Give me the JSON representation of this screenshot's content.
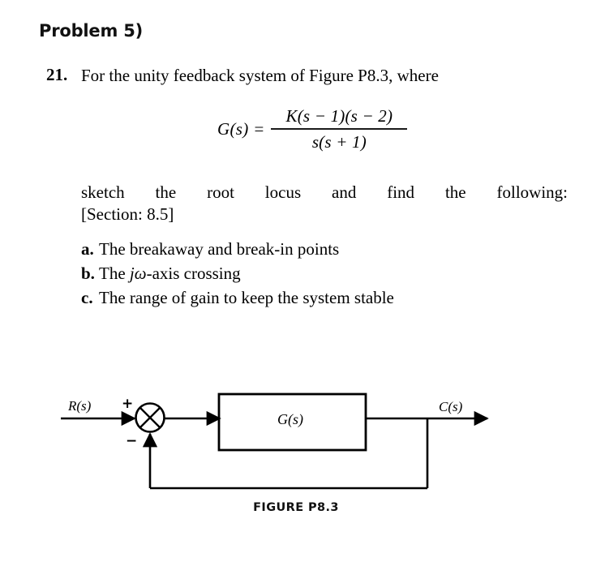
{
  "heading": {
    "title": "Problem 5)"
  },
  "statement": {
    "number": "21.",
    "text": "For the unity feedback system of Figure P8.3, where"
  },
  "equation": {
    "lhs": "G(s)",
    "equals": "=",
    "numerator_pre": "K",
    "numerator": "K(s − 1)(s − 2)",
    "denominator": "s(s + 1)"
  },
  "body": {
    "line1": "sketch the root locus and find the following:",
    "section_ref": "[Section: 8.5]"
  },
  "sub_items": [
    {
      "marker": "a.",
      "text_before": "The breakaway and break-in points",
      "italic": "",
      "text_after": ""
    },
    {
      "marker": "b.",
      "text_before": "The ",
      "italic": "jω",
      "text_after": "-axis crossing"
    },
    {
      "marker": "c.",
      "text_before": "The range of gain to keep the system stable",
      "italic": "",
      "text_after": ""
    }
  ],
  "diagram": {
    "input_label": "R(s)",
    "output_label": "C(s)",
    "block_label": "G(s)",
    "plus_sign": "+",
    "minus_sign": "−",
    "caption": "FIGURE P8.3",
    "stroke_color": "#000000"
  }
}
